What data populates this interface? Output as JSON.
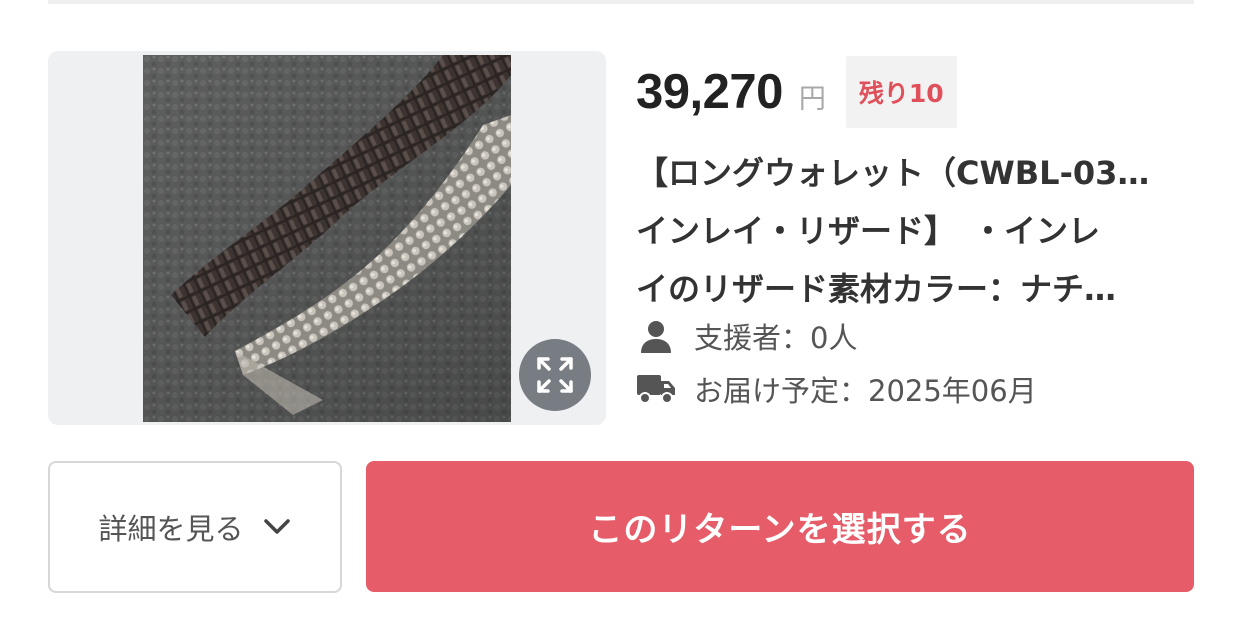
{
  "reward": {
    "price": "39,270",
    "currency": "円",
    "stock_badge": "残り10",
    "title_lines": [
      "【ロングウォレット（CWBL-03…",
      "インレイ・リザード】　・インレ",
      "イのリザード素材カラー：ナチ…"
    ],
    "supporters": "支援者：0人",
    "delivery": "お届け予定：2025年06月",
    "thumbnail_alt": "レザーストラップ（ブラックとナチュラルのリザード）",
    "detail_button": "詳細を見る",
    "select_button": "このリターンを選択する"
  },
  "icons": {
    "expand": "expand-icon",
    "person": "person-icon",
    "truck": "truck-icon",
    "chevron": "chevron-down-icon"
  },
  "colors": {
    "accent": "#e65c69",
    "badge_text": "#e0505a",
    "badge_bg": "#f2f2f2",
    "price_text": "#222222"
  }
}
